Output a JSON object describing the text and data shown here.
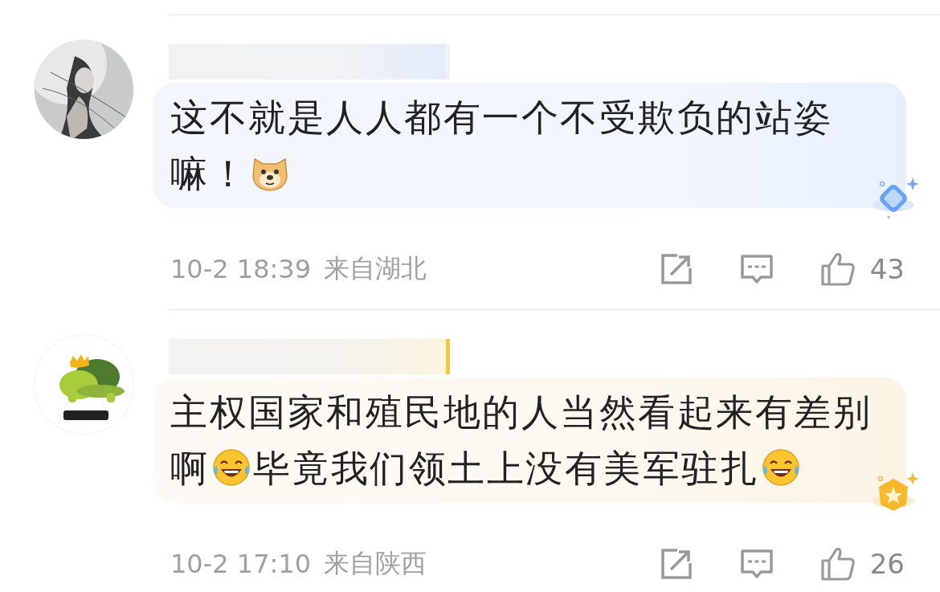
{
  "comments": [
    {
      "badge": {
        "kind": "diamond"
      },
      "parts": [
        {
          "kind": "text",
          "text": "这不就是人人都有一个不受欺负的站姿嘛！"
        },
        {
          "kind": "doge"
        }
      ],
      "time": "10-2 18:39",
      "location": "来自湖北",
      "likes": "43"
    },
    {
      "badge": {
        "kind": "star"
      },
      "parts": [
        {
          "kind": "text",
          "text": "主权国家和殖民地的人当然看起来有差别啊"
        },
        {
          "kind": "laugh"
        },
        {
          "kind": "text",
          "text": "毕竟我们领土上没有美军驻扎"
        },
        {
          "kind": "laugh"
        }
      ],
      "time": "10-2 17:10",
      "location": "来自陕西",
      "likes": "26"
    }
  ]
}
